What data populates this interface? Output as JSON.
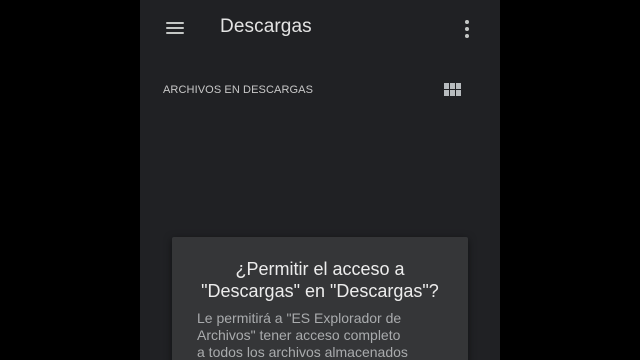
{
  "app_bar": {
    "title": "Descargas",
    "menu_icon": "hamburger-menu-icon",
    "overflow_icon": "more-vert-icon"
  },
  "section": {
    "header": "ARCHIVOS EN DESCARGAS",
    "view_icon": "grid-view-icon"
  },
  "dialog": {
    "title_line1": "¿Permitir el acceso a",
    "title_line2": "\"Descargas\" en \"Descargas\"?",
    "body_line1": "Le permitirá a \"ES Explorador de",
    "body_line2": "Archivos\" tener acceso completo",
    "body_line3": "a todos los archivos almacenados"
  },
  "colors": {
    "background": "#000000",
    "screen": "#202124",
    "dialog": "#353638",
    "primary_text": "#e3e3e3",
    "secondary_text": "#a9abad"
  }
}
